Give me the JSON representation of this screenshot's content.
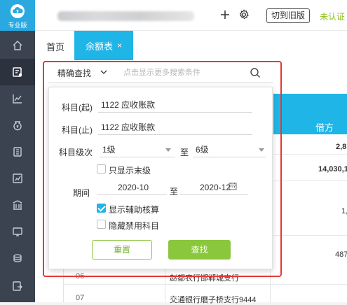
{
  "sidebar": {
    "logo_text": "专业版",
    "items": [
      {
        "icon": "home-icon"
      },
      {
        "icon": "voucher-icon"
      },
      {
        "icon": "chart-icon"
      },
      {
        "icon": "money-bag-icon"
      },
      {
        "icon": "book-icon"
      },
      {
        "icon": "report-icon"
      },
      {
        "icon": "building-icon"
      },
      {
        "icon": "monitor-icon"
      },
      {
        "icon": "stack-icon"
      },
      {
        "icon": "export-icon"
      }
    ]
  },
  "topbar": {
    "switch_label": "切到旧版",
    "status_label": "未认证"
  },
  "tabs": {
    "home": "首页",
    "active": "余额表",
    "close": "×"
  },
  "search": {
    "mode": "精确查找",
    "placeholder": "点击显示更多搜索条件"
  },
  "panel": {
    "subject_from_label": "科目(起)",
    "subject_from_value": "1122  应收账款",
    "subject_to_label": "科目(止)",
    "subject_to_value": "1122  应收账款",
    "level_label": "科目级次",
    "level_from": "1级",
    "level_sep": "至",
    "level_to": "6级",
    "only_leaf_label": "只显示末级",
    "only_leaf_checked": false,
    "period_label": "期间",
    "period_from": "2020-10",
    "period_sep": "至",
    "period_to": "2020-12",
    "show_aux_label": "显示辅助核算",
    "show_aux_checked": true,
    "hide_disabled_label": "隐藏禁用科目",
    "hide_disabled_checked": false,
    "reset_label": "重置",
    "search_label": "查找"
  },
  "table": {
    "debit_header": "借方",
    "values": [
      "2,8",
      "14,030,1",
      "1,",
      "487,"
    ],
    "rows": [
      {
        "code": "06",
        "bank": "赵都农行邯郸城支行"
      },
      {
        "code": "07",
        "bank": "交通银行磨子桥支行9444"
      }
    ]
  },
  "colors": {
    "accent": "#1fb5e6",
    "sidebar": "#3b4350",
    "green": "#8ac73d",
    "highlight": "#e53935"
  }
}
